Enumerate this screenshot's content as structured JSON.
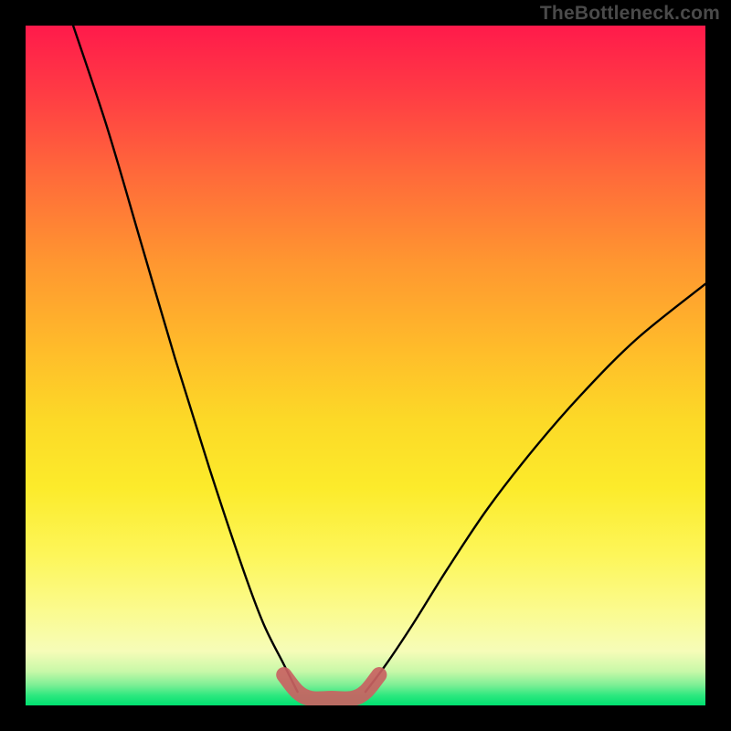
{
  "watermark": "TheBottleneck.com",
  "chart_data": {
    "type": "line",
    "title": "",
    "xlabel": "",
    "ylabel": "",
    "xlim": [
      0,
      100
    ],
    "ylim": [
      0,
      100
    ],
    "grid": false,
    "series": [
      {
        "name": "left-curve",
        "x": [
          7,
          12,
          17,
          22,
          27,
          32,
          35,
          38,
          40
        ],
        "values": [
          100,
          85,
          68,
          51,
          35,
          20,
          12,
          6,
          2
        ]
      },
      {
        "name": "right-curve",
        "x": [
          50,
          53,
          57,
          62,
          68,
          75,
          82,
          90,
          100
        ],
        "values": [
          2,
          6,
          12,
          20,
          29,
          38,
          46,
          54,
          62
        ]
      },
      {
        "name": "bottom-highlight",
        "x": [
          38,
          40,
          42,
          45,
          48,
          50,
          52
        ],
        "values": [
          4.5,
          2,
          1,
          1,
          1,
          2,
          4.5
        ]
      }
    ],
    "background_scale": {
      "note": "vertical heat gradient",
      "stops_pct": [
        0,
        10,
        22,
        35,
        48,
        58,
        68,
        78,
        86,
        92,
        95,
        97,
        98.5,
        100
      ],
      "colors": [
        "#FF1A4B",
        "#FF3C44",
        "#FF6A3A",
        "#FF9730",
        "#FFBD2A",
        "#FCD927",
        "#FCEB2B",
        "#FDF65A",
        "#FBFB8E",
        "#F6FCB8",
        "#C8F8A8",
        "#7DEF95",
        "#2EE87F",
        "#00E070"
      ]
    }
  }
}
